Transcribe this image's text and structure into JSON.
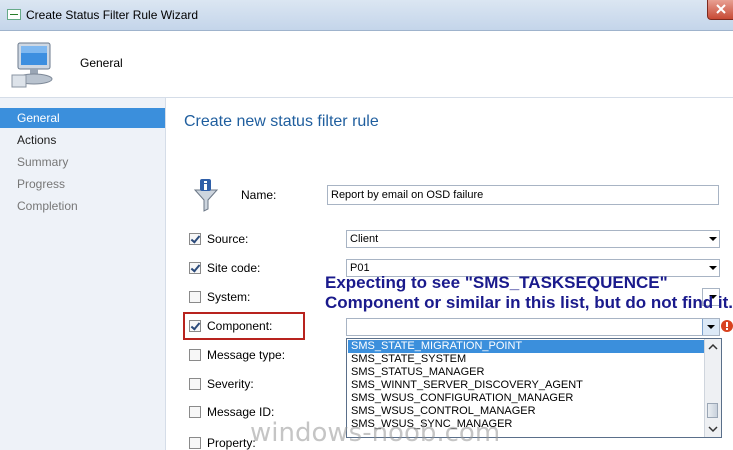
{
  "window": {
    "title": "Create Status Filter Rule Wizard"
  },
  "header": {
    "label": "General"
  },
  "nav": {
    "items": [
      "General",
      "Actions",
      "Summary",
      "Progress",
      "Completion"
    ]
  },
  "main": {
    "heading": "Create new status filter rule",
    "name_label": "Name:",
    "name_value": "Report by email on OSD failure",
    "rows": [
      {
        "label": "Source:",
        "checked": true,
        "value": "Client"
      },
      {
        "label": "Site code:",
        "checked": true,
        "value": "P01"
      },
      {
        "label": "System:",
        "checked": false,
        "value": ""
      },
      {
        "label": "Component:",
        "checked": true,
        "value": ""
      },
      {
        "label": "Message type:",
        "checked": false,
        "value": ""
      },
      {
        "label": "Severity:",
        "checked": false,
        "value": ""
      },
      {
        "label": "Message ID:",
        "checked": false,
        "value": ""
      },
      {
        "label": "Property:",
        "checked": false,
        "value": ""
      }
    ]
  },
  "callout": "Expecting to see \"SMS_TASKSEQUENCE\" Component or similar in this list, but do not find it.",
  "dropdown": {
    "items": [
      "SMS_STATE_MIGRATION_POINT",
      "SMS_STATE_SYSTEM",
      "SMS_STATUS_MANAGER",
      "SMS_WINNT_SERVER_DISCOVERY_AGENT",
      "SMS_WSUS_CONFIGURATION_MANAGER",
      "SMS_WSUS_CONTROL_MANAGER",
      "SMS_WSUS_SYNC_MANAGER"
    ],
    "selected_index": 0
  },
  "watermark": "windows-noob.com",
  "colors": {
    "accent": "#3b8fdc",
    "heading": "#1f5e9e",
    "callout": "#1a1a8c",
    "highlight": "#b8231e"
  }
}
